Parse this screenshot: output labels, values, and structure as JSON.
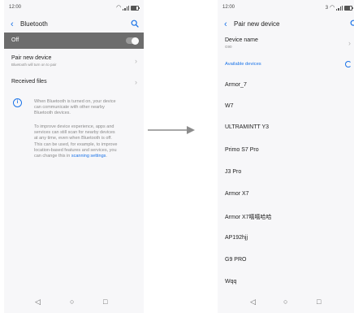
{
  "left": {
    "status": {
      "time": "12:00"
    },
    "header": {
      "title": "Bluetooth"
    },
    "bluetooth_toggle": {
      "label": "Off",
      "state": "off"
    },
    "pair_new_device": {
      "label": "Pair new device",
      "sublabel": "Bluetooth will turn on to pair"
    },
    "received_files": {
      "label": "Received files"
    },
    "info_lines_1": [
      "When Bluetooth is turned on, your device",
      "can communicate with other nearby",
      "Bluetooth devices."
    ],
    "info_lines_2": [
      "To improve device experience, apps and",
      "services can still scan for nearby devices",
      "at any time, even when Bluetooth is off.",
      "This can be used, for example, to improve",
      "location-based features and services, you"
    ],
    "info_last_prefix": "can change this in ",
    "info_link": "scanning settings",
    "info_last_suffix": "."
  },
  "right": {
    "status": {
      "time": "12:00",
      "badge": "3"
    },
    "header": {
      "title": "Pair new device"
    },
    "device_name": {
      "label": "Device name",
      "value": "G90"
    },
    "available_label": "Available devices",
    "devices": [
      "Armor_7",
      "W7",
      "ULTRAMINTT Y3",
      "Primo S7 Pro",
      "J3 Pro",
      "Armor X7",
      "Armor X7嘻嘻哈哈",
      "AP192hjj",
      "G9 PRO",
      "Wqq"
    ]
  },
  "nav": {
    "back": "◁",
    "home": "○",
    "recents": "□"
  },
  "colors": {
    "accent": "#1a73e8",
    "toggle_row_bg": "#6d6d6d",
    "arrow": "#8c8c8c"
  }
}
